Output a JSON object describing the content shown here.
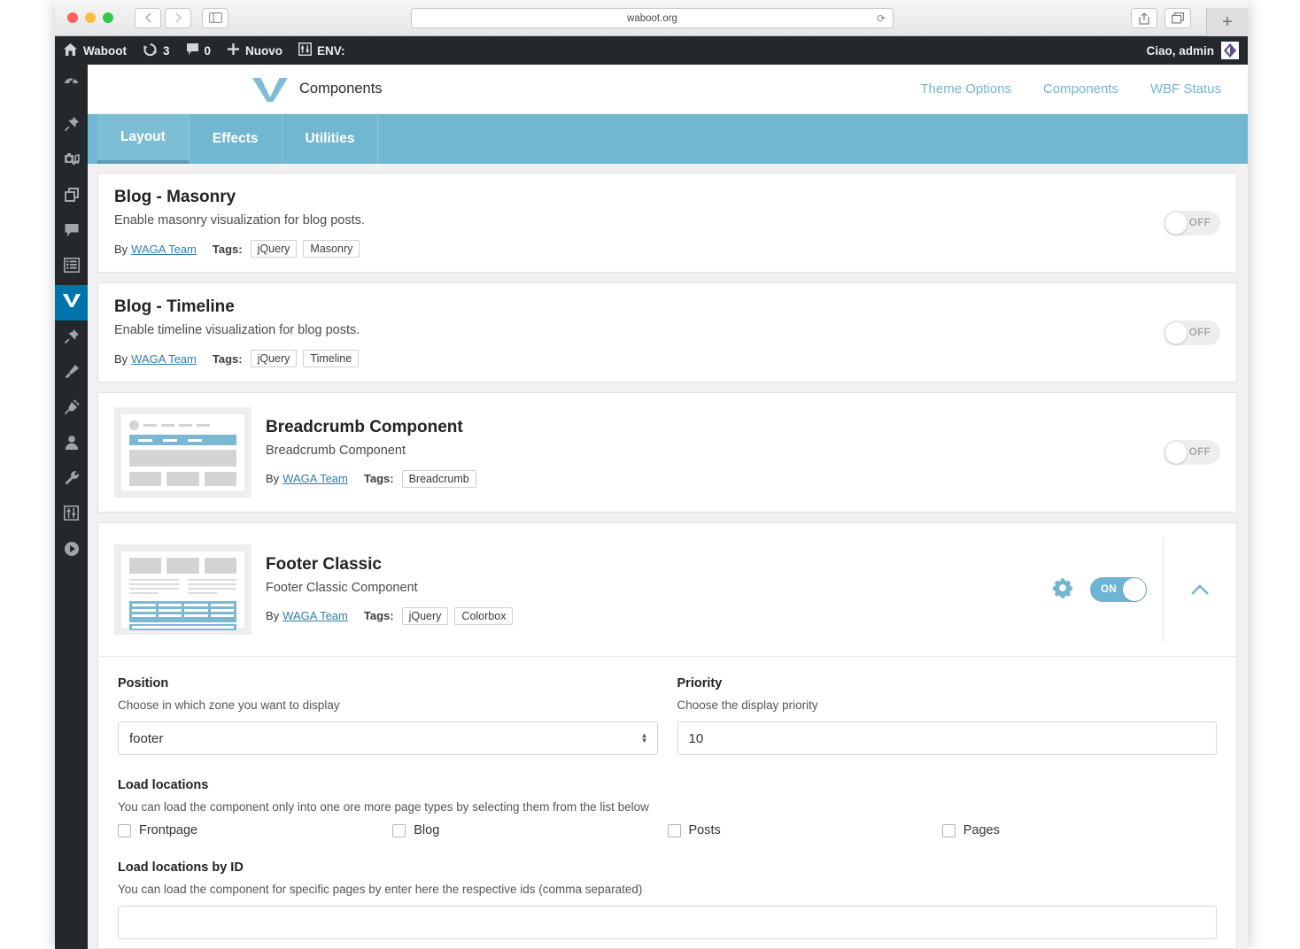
{
  "browser": {
    "url": "waboot.org",
    "back_icon": "chevron-left-icon",
    "forward_icon": "chevron-right-icon",
    "sidebar_icon": "sidebar-toggle-icon",
    "reload_icon": "reload-icon",
    "share_icon": "share-icon",
    "tabs_icon": "show-tabs-icon",
    "new_tab_label": "+"
  },
  "adminbar": {
    "home_icon": "wordpress-home-icon",
    "site_name": "Waboot",
    "updates_icon": "updates-icon",
    "updates_count": "3",
    "comments_icon": "comment-icon",
    "comments_count": "0",
    "new_icon": "plus-icon",
    "new_label": "Nuovo",
    "env_icon": "env-icon",
    "env_label": "ENV:",
    "greeting": "Ciao, admin",
    "avatar_name": "user-avatar"
  },
  "sidebar": {
    "items": [
      {
        "name": "sidebar-item-dashboard",
        "icon": "dashboard-gauge-icon",
        "active": false
      },
      {
        "name": "sidebar-item-posts",
        "icon": "pin-icon",
        "active": false
      },
      {
        "name": "sidebar-item-media",
        "icon": "media-camera-icon",
        "active": false
      },
      {
        "name": "sidebar-item-pages",
        "icon": "pages-copy-icon",
        "active": false
      },
      {
        "name": "sidebar-item-comments",
        "icon": "comment-bubble-icon",
        "active": false
      },
      {
        "name": "sidebar-item-list",
        "icon": "list-icon",
        "active": false
      },
      {
        "name": "sidebar-item-waboot",
        "icon": "waboot-w-icon",
        "active": true
      },
      {
        "name": "sidebar-item-appearance-pin",
        "icon": "pin-icon",
        "active": false
      },
      {
        "name": "sidebar-item-themes",
        "icon": "brush-icon",
        "active": false
      },
      {
        "name": "sidebar-item-plugins",
        "icon": "plug-icon",
        "active": false
      },
      {
        "name": "sidebar-item-users",
        "icon": "user-icon",
        "active": false
      },
      {
        "name": "sidebar-item-tools",
        "icon": "wrench-icon",
        "active": false
      },
      {
        "name": "sidebar-item-settings",
        "icon": "sliders-icon",
        "active": false
      },
      {
        "name": "sidebar-item-collapse",
        "icon": "play-circle-icon",
        "active": false
      }
    ]
  },
  "header": {
    "logo_icon": "waboot-logo-icon",
    "brand_title": "Components",
    "nav": [
      {
        "label": "Theme Options",
        "name": "nav-theme-options"
      },
      {
        "label": "Components",
        "name": "nav-components"
      },
      {
        "label": "WBF Status",
        "name": "nav-wbf-status"
      }
    ]
  },
  "tabs": [
    {
      "label": "Layout",
      "name": "tab-layout",
      "active": true
    },
    {
      "label": "Effects",
      "name": "tab-effects",
      "active": false
    },
    {
      "label": "Utilities",
      "name": "tab-utilities",
      "active": false
    }
  ],
  "labels": {
    "by": "By",
    "tags": "Tags:",
    "toggle_off": "OFF",
    "toggle_on": "ON"
  },
  "components": [
    {
      "title": "Blog - Masonry",
      "description": "Enable masonry visualization for blog posts.",
      "author": "WAGA Team",
      "tags": [
        "jQuery",
        "Masonry"
      ],
      "state": "OFF",
      "has_thumb": false
    },
    {
      "title": "Blog - Timeline",
      "description": "Enable timeline visualization for blog posts.",
      "author": "WAGA Team",
      "tags": [
        "jQuery",
        "Timeline"
      ],
      "state": "OFF",
      "has_thumb": false
    },
    {
      "title": "Breadcrumb Component",
      "description": "Breadcrumb Component",
      "author": "WAGA Team",
      "tags": [
        "Breadcrumb"
      ],
      "state": "OFF",
      "has_thumb": true
    },
    {
      "title": "Footer Classic",
      "description": "Footer Classic Component",
      "author": "WAGA Team",
      "tags": [
        "jQuery",
        "Colorbox"
      ],
      "state": "ON",
      "has_thumb": true
    }
  ],
  "settings": {
    "position": {
      "label": "Position",
      "help": "Choose in which zone you want to display",
      "value": "footer"
    },
    "priority": {
      "label": "Priority",
      "help": "Choose the display priority",
      "value": "10"
    },
    "load_locations": {
      "label": "Load locations",
      "help": "You can load the component only into one ore more page types by selecting them from the list below",
      "options": [
        {
          "label": "Frontpage",
          "checked": false
        },
        {
          "label": "Blog",
          "checked": false
        },
        {
          "label": "Posts",
          "checked": false
        },
        {
          "label": "Pages",
          "checked": false
        }
      ]
    },
    "load_by_id": {
      "label": "Load locations by ID",
      "help": "You can load the component for specific pages by enter here the respective ids (comma separated)",
      "value": ""
    }
  },
  "colors": {
    "accent": "#72b7d1",
    "wp_dark": "#23282d",
    "wp_active": "#0073aa",
    "link": "#2f7fa8"
  }
}
